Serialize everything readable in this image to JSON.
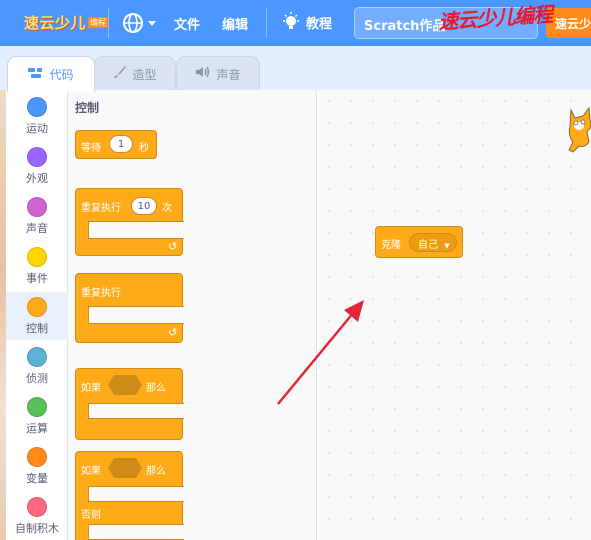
{
  "menubar": {
    "logo_text": "速云少儿",
    "logo_sub": "编程",
    "file": "文件",
    "edit": "编辑",
    "tutorial": "教程",
    "project_title": "Scratch作品",
    "share_label": "速云少",
    "watermark": "速云少儿编程",
    "accent": "#4c97ff"
  },
  "tabs": [
    {
      "label": "代码",
      "icon": "code-icon"
    },
    {
      "label": "造型",
      "icon": "brush-icon"
    },
    {
      "label": "声音",
      "icon": "speaker-icon"
    }
  ],
  "categories": [
    {
      "label": "运动",
      "color": "#4c97ff"
    },
    {
      "label": "外观",
      "color": "#9966ff"
    },
    {
      "label": "声音",
      "color": "#cf63cf"
    },
    {
      "label": "事件",
      "color": "#ffd500"
    },
    {
      "label": "控制",
      "color": "#ffab19"
    },
    {
      "label": "侦测",
      "color": "#5cb1d6"
    },
    {
      "label": "运算",
      "color": "#59c059"
    },
    {
      "label": "变量",
      "color": "#ff8c1a"
    },
    {
      "label": "自制积木",
      "color": "#ff6680"
    }
  ],
  "palette": {
    "title": "控制",
    "wait_label": "等待",
    "wait_value": "1",
    "wait_unit": "秒",
    "repeat_label": "重复执行",
    "repeat_value": "10",
    "repeat_unit": "次",
    "forever_label": "重复执行",
    "if_label": "如果",
    "then_label": "那么",
    "if2_label": "如果",
    "then2_label": "那么",
    "else_label": "否则"
  },
  "workspace": {
    "clone_label": "克隆",
    "clone_target": "自己"
  }
}
